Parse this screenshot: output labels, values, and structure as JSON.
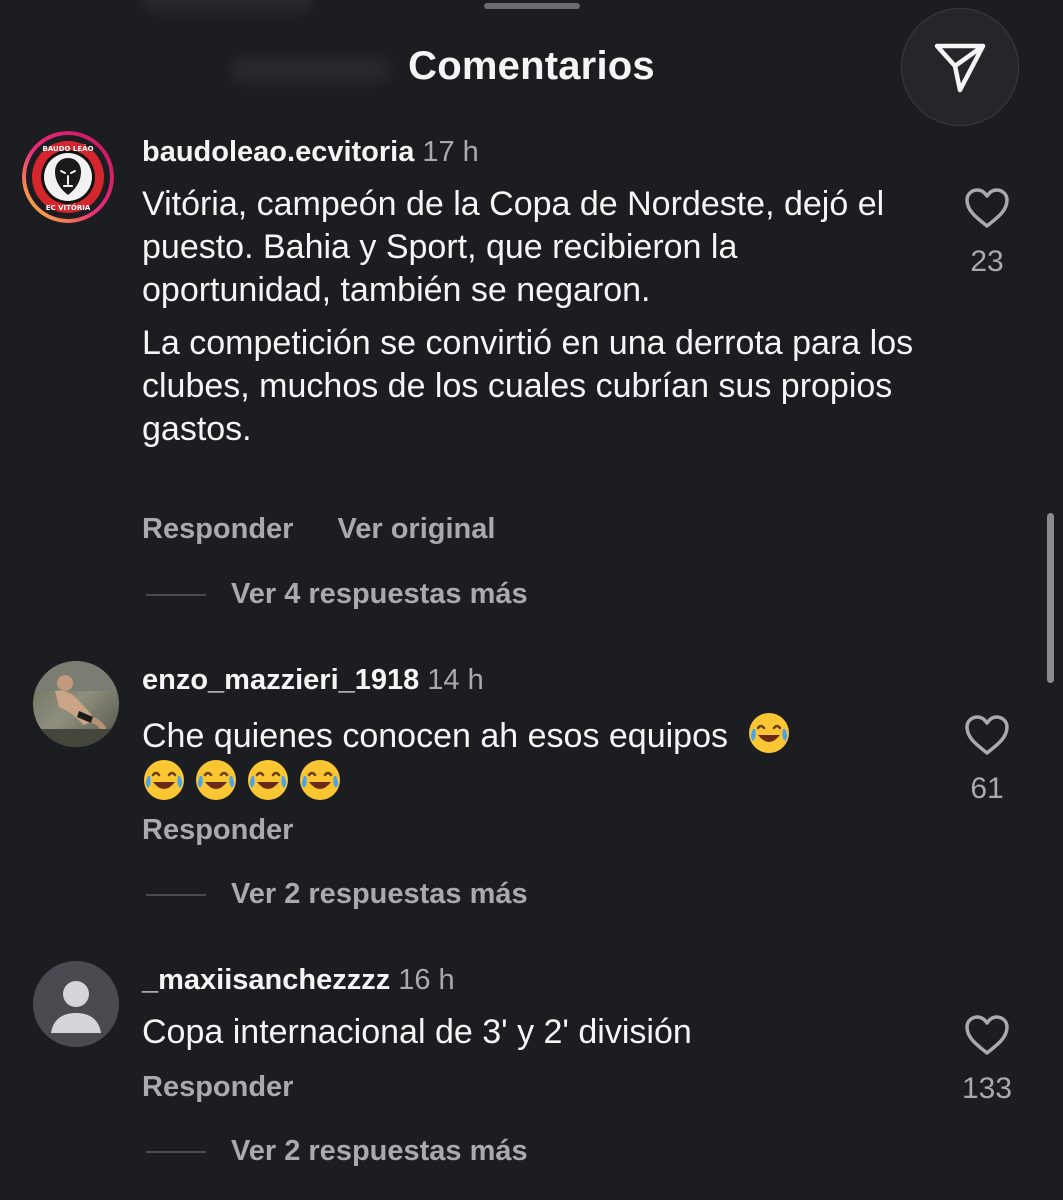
{
  "header": {
    "title": "Comentarios",
    "share_icon": "paper-plane-icon"
  },
  "comments": [
    {
      "username": "baudoleao.ecvitoria",
      "time": "17 h",
      "paragraphs": [
        "Vitória, campeón de la Copa de Nordeste, dejó el puesto. Bahia y Sport, que recibieron la oportunidad, también se negaron.",
        "La competición se convirtió en una derrota para los clubes, muchos de los cuales cubrían sus propios gastos."
      ],
      "reply_label": "Responder",
      "translate_label": "Ver original",
      "view_replies": "Ver 4 respuestas más",
      "likes": "23",
      "avatar_text_top": "BAUDO LEÃO",
      "avatar_text_bottom": "EC VITÓRIA"
    },
    {
      "username": "enzo_mazzieri_1918",
      "time": "14 h",
      "text": "Che quienes conocen ah esos equipos",
      "emojis": "😂😂😂😂😂",
      "reply_label": "Responder",
      "view_replies": "Ver 2 respuestas más",
      "likes": "61"
    },
    {
      "username": "_maxiisanchezzzz",
      "time": "16 h",
      "text": "Copa internacional de 3' y 2' división",
      "reply_label": "Responder",
      "view_replies": "Ver 2 respuestas más",
      "likes": "133"
    }
  ],
  "colors": {
    "background": "#1c1d21",
    "text_primary": "#f5f5f5",
    "text_secondary": "#a9aaae",
    "story_ring_start": "#f9ce34",
    "story_ring_mid": "#ee2a7b",
    "story_ring_end": "#6228d7"
  }
}
